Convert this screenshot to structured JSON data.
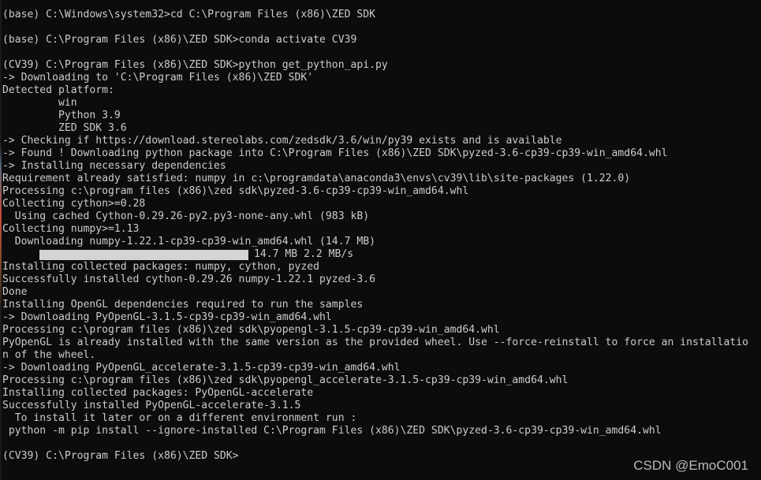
{
  "terminal": {
    "lines": [
      "(base) C:\\Windows\\system32>cd C:\\Program Files (x86)\\ZED SDK",
      "",
      "(base) C:\\Program Files (x86)\\ZED SDK>conda activate CV39",
      "",
      "(CV39) C:\\Program Files (x86)\\ZED SDK>python get_python_api.py",
      "-> Downloading to 'C:\\Program Files (x86)\\ZED SDK'",
      "Detected platform:",
      "         win",
      "         Python 3.9",
      "         ZED SDK 3.6",
      "-> Checking if https://download.stereolabs.com/zedsdk/3.6/win/py39 exists and is available",
      "-> Found ! Downloading python package into C:\\Program Files (x86)\\ZED SDK\\pyzed-3.6-cp39-cp39-win_amd64.whl",
      "-> Installing necessary dependencies",
      "Requirement already satisfied: numpy in c:\\programdata\\anaconda3\\envs\\cv39\\lib\\site-packages (1.22.0)",
      "Processing c:\\program files (x86)\\zed sdk\\pyzed-3.6-cp39-cp39-win_amd64.whl",
      "Collecting cython>=0.28",
      "  Using cached Cython-0.29.26-py2.py3-none-any.whl (983 kB)",
      "Collecting numpy>=1.13",
      "  Downloading numpy-1.22.1-cp39-cp39-win_amd64.whl (14.7 MB)"
    ],
    "progress": {
      "fraction": 1.0,
      "text": "14.7 MB 2.2 MB/s"
    },
    "lines_after": [
      "Installing collected packages: numpy, cython, pyzed",
      "Successfully installed cython-0.29.26 numpy-1.22.1 pyzed-3.6",
      "Done",
      "Installing OpenGL dependencies required to run the samples",
      "-> Downloading PyOpenGL-3.1.5-cp39-cp39-win_amd64.whl",
      "Processing c:\\program files (x86)\\zed sdk\\pyopengl-3.1.5-cp39-cp39-win_amd64.whl",
      "PyOpenGL is already installed with the same version as the provided wheel. Use --force-reinstall to force an installatio",
      "n of the wheel.",
      "-> Downloading PyOpenGL_accelerate-3.1.5-cp39-cp39-win_amd64.whl",
      "Processing c:\\program files (x86)\\zed sdk\\pyopengl_accelerate-3.1.5-cp39-cp39-win_amd64.whl",
      "Installing collected packages: PyOpenGL-accelerate",
      "Successfully installed PyOpenGL-accelerate-3.1.5",
      "  To install it later or on a different environment run :",
      " python -m pip install --ignore-installed C:\\Program Files (x86)\\ZED SDK\\pyzed-3.6-cp39-cp39-win_amd64.whl",
      "",
      "(CV39) C:\\Program Files (x86)\\ZED SDK>"
    ]
  },
  "watermark": "CSDN @EmoC001",
  "colors": {
    "background": "#0c0c0c",
    "text": "#cccccc",
    "progress_fill": "#d4d4d4"
  }
}
